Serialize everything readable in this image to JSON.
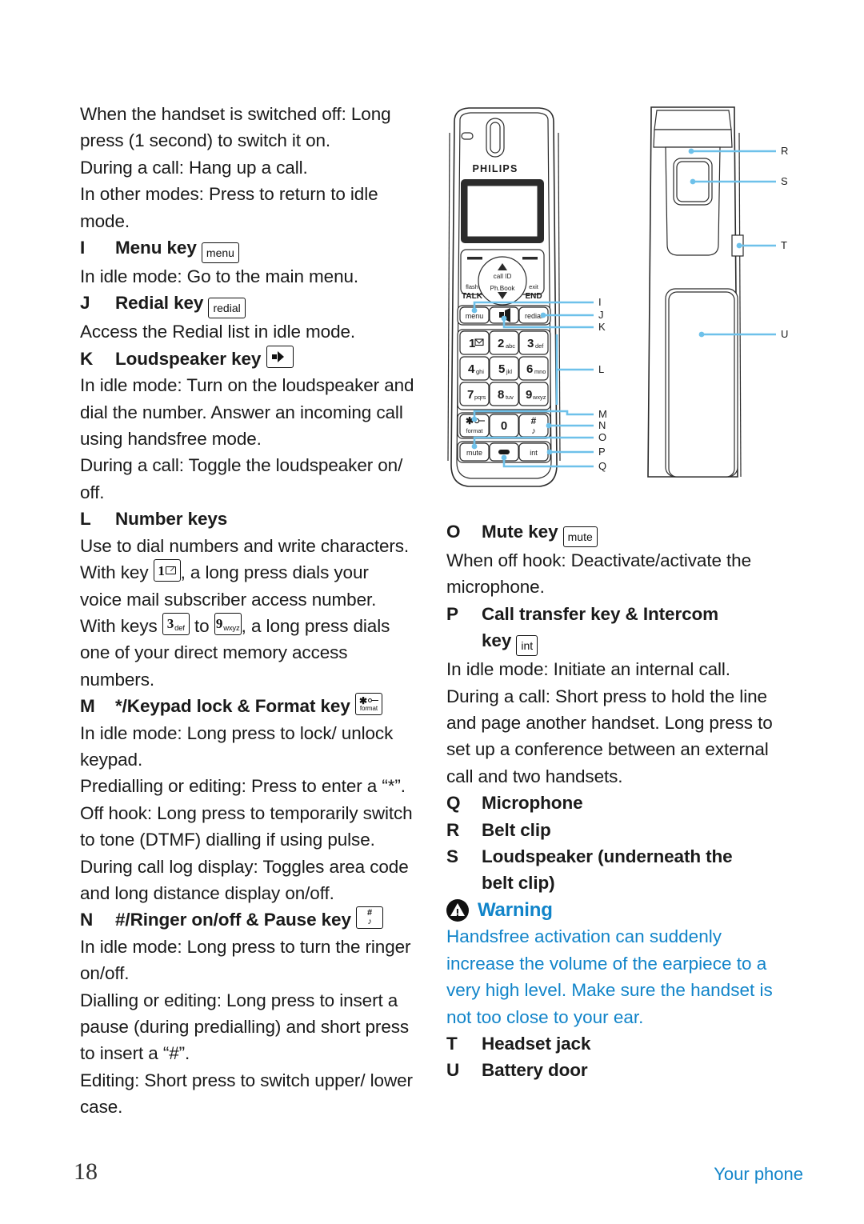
{
  "colors": {
    "accent_blue": "#2196d6",
    "warning_blue": "#1184c9",
    "text": "#1a1a1a",
    "callout_line": "#6ec1ea"
  },
  "footer": {
    "page_number": "18",
    "section": "Your phone"
  },
  "left_column": {
    "intro": [
      "When the handset is switched off: Long press (1 second) to switch it on.",
      "During a call: Hang up a call.",
      "In other modes: Press to return to idle mode."
    ],
    "entries": [
      {
        "letter": "I",
        "title": "Menu key",
        "key_icon": "menu-key-chip",
        "key_label": "menu",
        "body": [
          "In idle mode: Go to the main menu."
        ]
      },
      {
        "letter": "J",
        "title": "Redial key",
        "key_icon": "redial-key-chip",
        "key_label": "redial",
        "body": [
          "Access the Redial list in idle mode."
        ]
      },
      {
        "letter": "K",
        "title": "Loudspeaker key",
        "key_icon": "loudspeaker-key-chip",
        "key_label": "",
        "body": [
          "In idle mode: Turn on the loudspeaker and dial the number. Answer an incoming call using handsfree mode.",
          "During a call: Toggle the loudspeaker on/ off."
        ]
      },
      {
        "letter": "L",
        "title": "Number keys",
        "key_icon": "",
        "key_label": "",
        "body": [
          "Use to dial numbers and write characters.",
          "voice mail subscriber access number.",
          "one of your direct memory access numbers."
        ],
        "inline_1_prefix": "With key",
        "inline_1_key_digit": "1",
        "inline_1_key_sub": "envelope-icon",
        "inline_1_suffix": ", a long press dials your",
        "inline_2_prefix": "With keys",
        "inline_2_key_digit": "3",
        "inline_2_key_sub": "def",
        "inline_2_mid": "to",
        "inline_2_key2_digit": "9",
        "inline_2_key2_sub": "wxyz",
        "inline_2_suffix": ", a long press dials"
      },
      {
        "letter": "M",
        "title": "*/Keypad lock & Format key",
        "key_icon": "star-format-key-chip",
        "key_label": "format",
        "body": [
          "In idle mode: Long press to lock/ unlock keypad.",
          "Predialling or editing: Press to enter a “*”.",
          "Off hook: Long press to temporarily switch to tone (DTMF) dialling if using pulse.",
          "During call log display: Toggles area code and long distance display on/off."
        ]
      },
      {
        "letter": "N",
        "title": "#/Ringer on/off & Pause key",
        "key_icon": "hash-ringer-key-chip",
        "key_label": "#",
        "body": [
          "In idle mode: Long press to turn the ringer on/off.",
          "Dialling or editing: Long press to insert a pause (during predialling) and short press to insert a “#”.",
          "Editing: Short press to switch upper/ lower case."
        ]
      }
    ]
  },
  "right_column": {
    "entries": [
      {
        "letter": "O",
        "title": "Mute key",
        "key_icon": "mute-key-chip",
        "key_label": "mute",
        "body": [
          "When off hook: Deactivate/activate the microphone."
        ]
      },
      {
        "letter": "P",
        "title": "Call transfer key & Intercom",
        "title_line2": "key",
        "key_icon": "int-key-chip",
        "key_label": "int",
        "body": [
          "In idle mode: Initiate an internal call.",
          "During a call: Short press to hold the line and page another handset. Long press to set up a conference between an external call and two handsets."
        ]
      },
      {
        "letter": "Q",
        "title": "Microphone",
        "body": []
      },
      {
        "letter": "R",
        "title": "Belt clip",
        "body": []
      },
      {
        "letter": "S",
        "title": "Loudspeaker (underneath the",
        "title_line2": "belt clip)",
        "body": []
      }
    ],
    "warning": {
      "icon": "warning-triangle-icon",
      "title": "Warning",
      "text": "Handsfree activation can suddenly increase the volume of the earpiece to a very high level. Make sure the handset is not too close to your ear."
    },
    "entries_after_warning": [
      {
        "letter": "T",
        "title": "Headset jack"
      },
      {
        "letter": "U",
        "title": "Battery door"
      }
    ]
  },
  "figure": {
    "brand": "PHILIPS",
    "nav": {
      "up_label": "call ID",
      "down_label": "Ph.Book",
      "left_top": "flash",
      "left_bottom": "TALK",
      "right_top": "exit",
      "right_bottom": "END"
    },
    "soft_keys": [
      {
        "label": "menu",
        "name": "menu-key"
      },
      {
        "label": "",
        "name": "loudspeaker-key"
      },
      {
        "label": "redial",
        "name": "redial-key"
      }
    ],
    "keypad": [
      {
        "digit": "1",
        "letters": "",
        "name": "key-1"
      },
      {
        "digit": "2",
        "letters": "abc",
        "name": "key-2"
      },
      {
        "digit": "3",
        "letters": "def",
        "name": "key-3"
      },
      {
        "digit": "4",
        "letters": "ghi",
        "name": "key-4"
      },
      {
        "digit": "5",
        "letters": "jkl",
        "name": "key-5"
      },
      {
        "digit": "6",
        "letters": "mno",
        "name": "key-6"
      },
      {
        "digit": "7",
        "letters": "pqrs",
        "name": "key-7"
      },
      {
        "digit": "8",
        "letters": "tuv",
        "name": "key-8"
      },
      {
        "digit": "9",
        "letters": "wxyz",
        "name": "key-9"
      }
    ],
    "bottom_rows": [
      {
        "label": "format",
        "name": "star-format-key"
      },
      {
        "label": "0",
        "name": "key-0"
      },
      {
        "label": "#",
        "name": "hash-ringer-key"
      },
      {
        "label": "mute",
        "name": "mute-key"
      },
      {
        "label": "",
        "name": "microphone"
      },
      {
        "label": "int",
        "name": "int-key"
      }
    ],
    "callouts_front": [
      "I",
      "J",
      "K",
      "L",
      "M",
      "N",
      "O",
      "P",
      "Q"
    ],
    "callouts_back": [
      "R",
      "S",
      "T",
      "U"
    ]
  }
}
